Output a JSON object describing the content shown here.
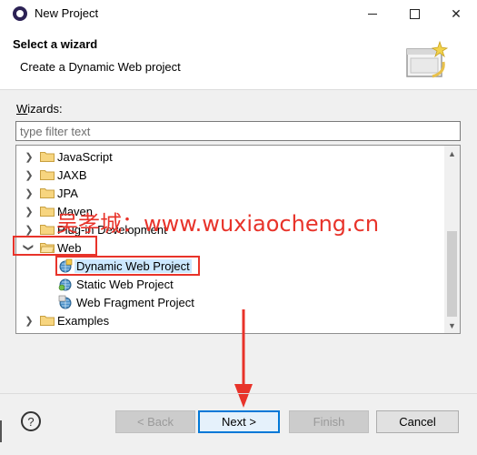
{
  "window": {
    "title": "New Project",
    "controls": {
      "minimize": "minimize",
      "maximize": "maximize",
      "close": "✕"
    }
  },
  "header": {
    "title": "Select a wizard",
    "description": "Create a Dynamic Web project"
  },
  "wizards": {
    "label_prefix": "W",
    "label_rest": "izards:",
    "filter_placeholder": "type filter text"
  },
  "tree": {
    "items": [
      {
        "label": "JavaScript",
        "type": "folder",
        "expanded": false
      },
      {
        "label": "JAXB",
        "type": "folder",
        "expanded": false
      },
      {
        "label": "JPA",
        "type": "folder",
        "expanded": false
      },
      {
        "label": "Maven",
        "type": "folder",
        "expanded": false
      },
      {
        "label": "Plug-in Development",
        "type": "folder",
        "expanded": false
      },
      {
        "label": "Web",
        "type": "folder",
        "expanded": true
      },
      {
        "label": "Dynamic Web Project",
        "type": "project",
        "selected": true
      },
      {
        "label": "Static Web Project",
        "type": "project"
      },
      {
        "label": "Web Fragment Project",
        "type": "project"
      },
      {
        "label": "Examples",
        "type": "folder",
        "expanded": false
      }
    ]
  },
  "watermark": "吴孝城：www.wuxiaocheng.cn",
  "buttons": {
    "help": "?",
    "back": "< Back",
    "next": "Next >",
    "finish": "Finish",
    "cancel": "Cancel"
  },
  "colors": {
    "highlight": "#e8332a",
    "primary_border": "#0078d7",
    "selection": "#cce8ff"
  }
}
